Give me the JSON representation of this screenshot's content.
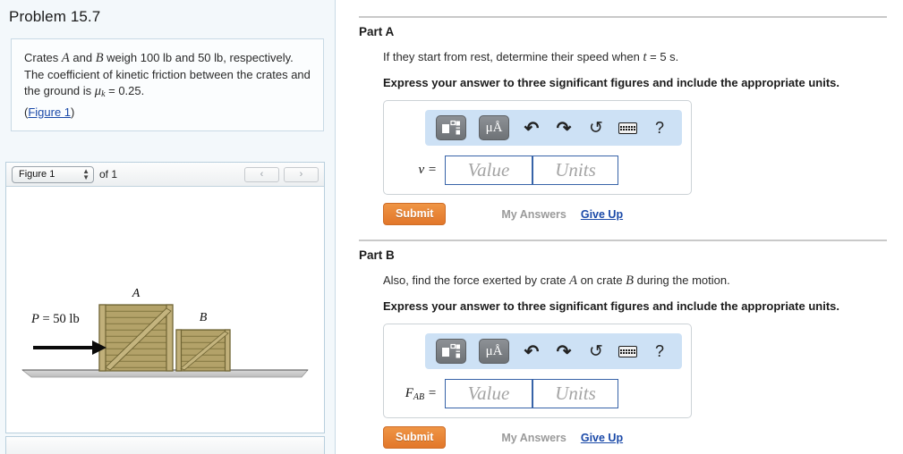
{
  "problem": {
    "title": "Problem 15.7",
    "statement_lines": [
      "Crates A and B weigh 100 lb and 50 lb, respectively.",
      "The coefficient of kinetic friction between the crates and",
      "the ground is μk = 0.25."
    ],
    "figure_link": "Figure 1",
    "figure_link_open": "(",
    "figure_link_close": ")"
  },
  "figure_panel": {
    "selected_figure": "Figure 1",
    "spinner_glyph": "⬍",
    "of_label": "of 1",
    "prev_glyph": "‹",
    "next_glyph": "›"
  },
  "diagram": {
    "crate_a_label": "A",
    "crate_b_label": "B",
    "force_label": "P = 50 lb",
    "crate_fill": "#b3a269",
    "crate_stroke": "#6f6434",
    "ground_fill": "#c6c6c6"
  },
  "parts": [
    {
      "id": "A",
      "heading": "Part A",
      "question_prefix": "If they start from rest, determine their speed when ",
      "question_var": "t",
      "question_suffix": " = 5 s.",
      "instruction": "Express your answer to three significant figures and include the appropriate units.",
      "variable": "v",
      "variable_sub": "",
      "variable_eq": " =",
      "value_placeholder": "Value",
      "units_placeholder": "Units",
      "value_text": "",
      "units_text": "",
      "submit_label": "Submit",
      "my_answers_label": "My Answers",
      "give_up_label": "Give Up"
    },
    {
      "id": "B",
      "heading": "Part B",
      "question_prefix": "Also, find the force exerted by crate ",
      "question_var": "A",
      "question_mid": " on crate ",
      "question_var2": "B",
      "question_suffix": " during the motion.",
      "instruction": "Express your answer to three significant figures and include the appropriate units.",
      "variable": "F",
      "variable_sub": "AB",
      "variable_eq": " =",
      "value_placeholder": "Value",
      "units_placeholder": "Units",
      "value_text": "",
      "units_text": "",
      "submit_label": "Submit",
      "my_answers_label": "My Answers",
      "give_up_label": "Give Up"
    }
  ],
  "toolbar": {
    "template_icon_name": "math-template-icon",
    "units_icon_label": "μÅ",
    "undo_glyph": "↶",
    "redo_glyph": "↷",
    "reset_glyph": "↺",
    "keyboard_icon_name": "keyboard-icon",
    "help_glyph": "?"
  },
  "colors": {
    "accent_orange": "#e2772a",
    "link_blue": "#1a49a8",
    "toolbar_blue": "#cde1f5",
    "input_border": "#3763a8",
    "panel_bg": "#f3f8fb"
  }
}
